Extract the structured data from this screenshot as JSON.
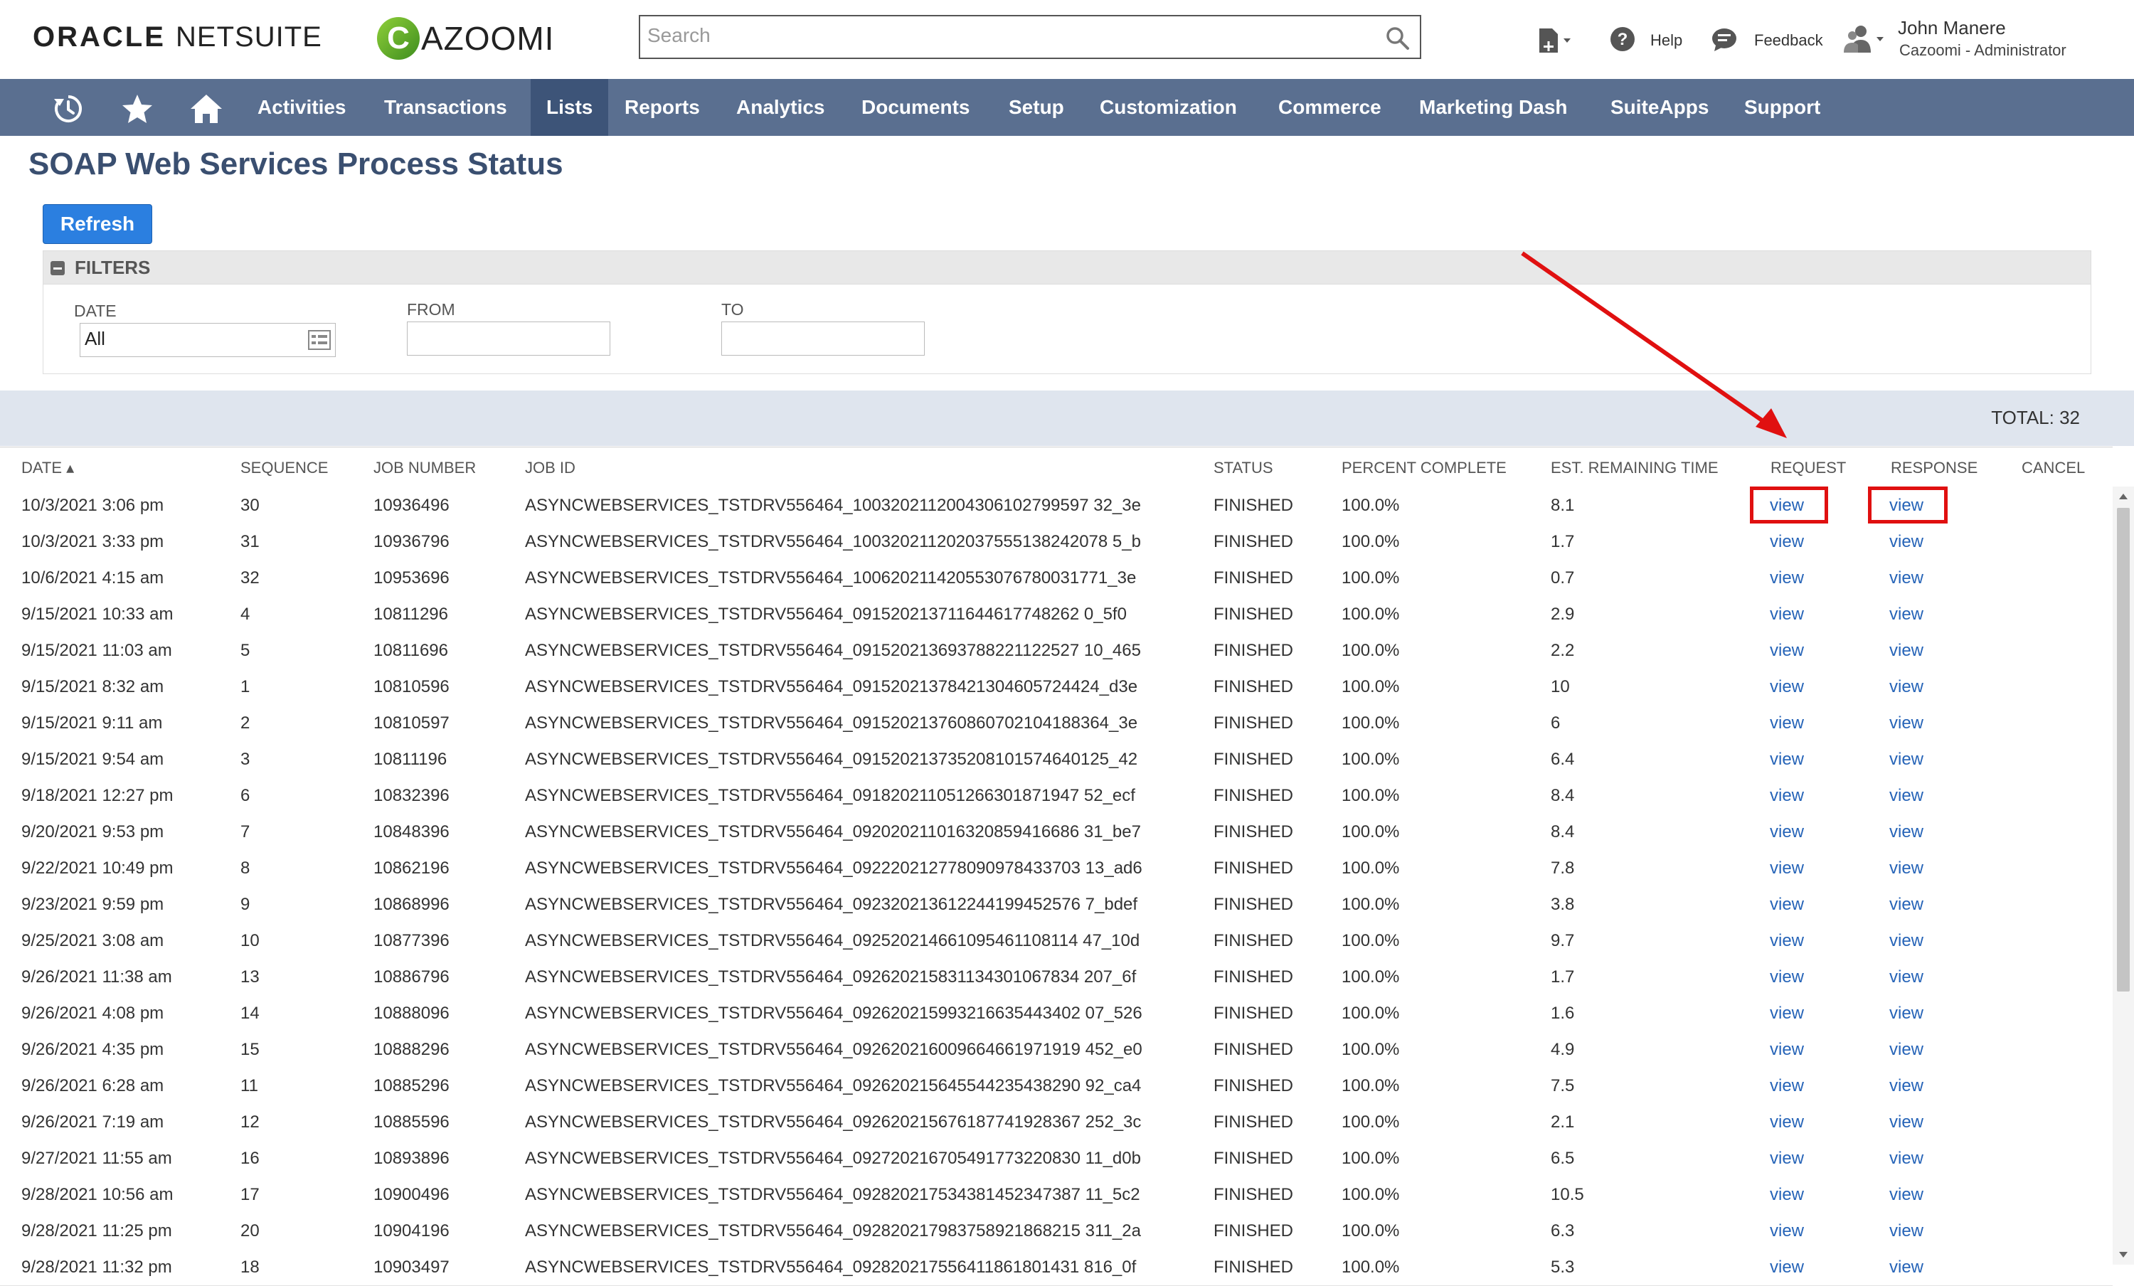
{
  "header": {
    "logo_oracle": "ORACLE",
    "logo_netsuite": "NETSUITE",
    "logo_cazoomi_initial": "C",
    "logo_cazoomi_rest": "AZOOMI",
    "search_placeholder": "Search",
    "help_label": "Help",
    "feedback_label": "Feedback",
    "user_name": "John Manere",
    "user_role": "Cazoomi - Administrator"
  },
  "nav": {
    "items": [
      "Activities",
      "Transactions",
      "Lists",
      "Reports",
      "Analytics",
      "Documents",
      "Setup",
      "Customization",
      "Commerce",
      "Marketing Dash",
      "SuiteApps",
      "Support"
    ],
    "active": "Lists"
  },
  "page": {
    "title": "SOAP Web Services Process Status",
    "refresh_label": "Refresh",
    "filters_title": "FILTERS",
    "date_label": "DATE",
    "date_value": "All",
    "from_label": "FROM",
    "to_label": "TO",
    "total_label": "TOTAL: 32"
  },
  "table": {
    "headers": {
      "date": "DATE ▴",
      "sequence": "SEQUENCE",
      "job_number": "JOB NUMBER",
      "job_id": "JOB ID",
      "status": "STATUS",
      "percent": "PERCENT COMPLETE",
      "remaining": "EST. REMAINING TIME",
      "request": "REQUEST",
      "response": "RESPONSE",
      "cancel": "CANCEL"
    },
    "rows": [
      {
        "date": "10/3/2021 3:06 pm",
        "seq": "30",
        "job": "10936496",
        "id": "ASYNCWEBSERVICES_TSTDRV556464_1003202112004306102799597 32_3e",
        "status": "FINISHED",
        "pct": "100.0%",
        "rem": "8.1",
        "req": "view",
        "resp": "view"
      },
      {
        "date": "10/3/2021 3:33 pm",
        "seq": "31",
        "job": "10936796",
        "id": "ASYNCWEBSERVICES_TSTDRV556464_100320211202037555138242078 5_b",
        "status": "FINISHED",
        "pct": "100.0%",
        "rem": "1.7",
        "req": "view",
        "resp": "view"
      },
      {
        "date": "10/6/2021 4:15 am",
        "seq": "32",
        "job": "10953696",
        "id": "ASYNCWEBSERVICES_TSTDRV556464_100620211420553076780031771_3e",
        "status": "FINISHED",
        "pct": "100.0%",
        "rem": "0.7",
        "req": "view",
        "resp": "view"
      },
      {
        "date": "9/15/2021 10:33 am",
        "seq": "4",
        "job": "10811296",
        "id": "ASYNCWEBSERVICES_TSTDRV556464_091520213711644617748262 0_5f0",
        "status": "FINISHED",
        "pct": "100.0%",
        "rem": "2.9",
        "req": "view",
        "resp": "view"
      },
      {
        "date": "9/15/2021 11:03 am",
        "seq": "5",
        "job": "10811696",
        "id": "ASYNCWEBSERVICES_TSTDRV556464_091520213693788221122527 10_465",
        "status": "FINISHED",
        "pct": "100.0%",
        "rem": "2.2",
        "req": "view",
        "resp": "view"
      },
      {
        "date": "9/15/2021 8:32 am",
        "seq": "1",
        "job": "10810596",
        "id": "ASYNCWEBSERVICES_TSTDRV556464_09152021378421304605724424_d3e",
        "status": "FINISHED",
        "pct": "100.0%",
        "rem": "10",
        "req": "view",
        "resp": "view"
      },
      {
        "date": "9/15/2021 9:11 am",
        "seq": "2",
        "job": "10810597",
        "id": "ASYNCWEBSERVICES_TSTDRV556464_091520213760860702104188364_3e",
        "status": "FINISHED",
        "pct": "100.0%",
        "rem": "6",
        "req": "view",
        "resp": "view"
      },
      {
        "date": "9/15/2021 9:54 am",
        "seq": "3",
        "job": "10811196",
        "id": "ASYNCWEBSERVICES_TSTDRV556464_091520213735208101574640125_42",
        "status": "FINISHED",
        "pct": "100.0%",
        "rem": "6.4",
        "req": "view",
        "resp": "view"
      },
      {
        "date": "9/18/2021 12:27 pm",
        "seq": "6",
        "job": "10832396",
        "id": "ASYNCWEBSERVICES_TSTDRV556464_091820211051266301871947 52_ecf",
        "status": "FINISHED",
        "pct": "100.0%",
        "rem": "8.4",
        "req": "view",
        "resp": "view"
      },
      {
        "date": "9/20/2021 9:53 pm",
        "seq": "7",
        "job": "10848396",
        "id": "ASYNCWEBSERVICES_TSTDRV556464_092020211016320859416686 31_be7",
        "status": "FINISHED",
        "pct": "100.0%",
        "rem": "8.4",
        "req": "view",
        "resp": "view"
      },
      {
        "date": "9/22/2021 10:49 pm",
        "seq": "8",
        "job": "10862196",
        "id": "ASYNCWEBSERVICES_TSTDRV556464_092220212778090978433703 13_ad6",
        "status": "FINISHED",
        "pct": "100.0%",
        "rem": "7.8",
        "req": "view",
        "resp": "view"
      },
      {
        "date": "9/23/2021 9:59 pm",
        "seq": "9",
        "job": "10868996",
        "id": "ASYNCWEBSERVICES_TSTDRV556464_092320213612244199452576 7_bdef",
        "status": "FINISHED",
        "pct": "100.0%",
        "rem": "3.8",
        "req": "view",
        "resp": "view"
      },
      {
        "date": "9/25/2021 3:08 am",
        "seq": "10",
        "job": "10877396",
        "id": "ASYNCWEBSERVICES_TSTDRV556464_092520214661095461108114 47_10d",
        "status": "FINISHED",
        "pct": "100.0%",
        "rem": "9.7",
        "req": "view",
        "resp": "view"
      },
      {
        "date": "9/26/2021 11:38 am",
        "seq": "13",
        "job": "10886796",
        "id": "ASYNCWEBSERVICES_TSTDRV556464_092620215831134301067834 207_6f",
        "status": "FINISHED",
        "pct": "100.0%",
        "rem": "1.7",
        "req": "view",
        "resp": "view"
      },
      {
        "date": "9/26/2021 4:08 pm",
        "seq": "14",
        "job": "10888096",
        "id": "ASYNCWEBSERVICES_TSTDRV556464_092620215993216635443402 07_526",
        "status": "FINISHED",
        "pct": "100.0%",
        "rem": "1.6",
        "req": "view",
        "resp": "view"
      },
      {
        "date": "9/26/2021 4:35 pm",
        "seq": "15",
        "job": "10888296",
        "id": "ASYNCWEBSERVICES_TSTDRV556464_092620216009664661971919 452_e0",
        "status": "FINISHED",
        "pct": "100.0%",
        "rem": "4.9",
        "req": "view",
        "resp": "view"
      },
      {
        "date": "9/26/2021 6:28 am",
        "seq": "11",
        "job": "10885296",
        "id": "ASYNCWEBSERVICES_TSTDRV556464_092620215645544235438290 92_ca4",
        "status": "FINISHED",
        "pct": "100.0%",
        "rem": "7.5",
        "req": "view",
        "resp": "view"
      },
      {
        "date": "9/26/2021 7:19 am",
        "seq": "12",
        "job": "10885596",
        "id": "ASYNCWEBSERVICES_TSTDRV556464_092620215676187741928367 252_3c",
        "status": "FINISHED",
        "pct": "100.0%",
        "rem": "2.1",
        "req": "view",
        "resp": "view"
      },
      {
        "date": "9/27/2021 11:55 am",
        "seq": "16",
        "job": "10893896",
        "id": "ASYNCWEBSERVICES_TSTDRV556464_092720216705491773220830 11_d0b",
        "status": "FINISHED",
        "pct": "100.0%",
        "rem": "6.5",
        "req": "view",
        "resp": "view"
      },
      {
        "date": "9/28/2021 10:56 am",
        "seq": "17",
        "job": "10900496",
        "id": "ASYNCWEBSERVICES_TSTDRV556464_092820217534381452347387 11_5c2",
        "status": "FINISHED",
        "pct": "100.0%",
        "rem": "10.5",
        "req": "view",
        "resp": "view"
      },
      {
        "date": "9/28/2021 11:25 pm",
        "seq": "20",
        "job": "10904196",
        "id": "ASYNCWEBSERVICES_TSTDRV556464_092820217983758921868215 311_2a",
        "status": "FINISHED",
        "pct": "100.0%",
        "rem": "6.3",
        "req": "view",
        "resp": "view"
      },
      {
        "date": "9/28/2021 11:32 pm",
        "seq": "18",
        "job": "10903497",
        "id": "ASYNCWEBSERVICES_TSTDRV556464_092820217556411861801431 816_0f",
        "status": "FINISHED",
        "pct": "100.0%",
        "rem": "5.3",
        "req": "view",
        "resp": "view"
      }
    ]
  },
  "colors": {
    "nav_bg": "#5a6f90",
    "nav_active": "#3d5478",
    "title": "#3a4f70",
    "link": "#2563b7",
    "button": "#2b7fe0",
    "annotation": "#e01010"
  }
}
